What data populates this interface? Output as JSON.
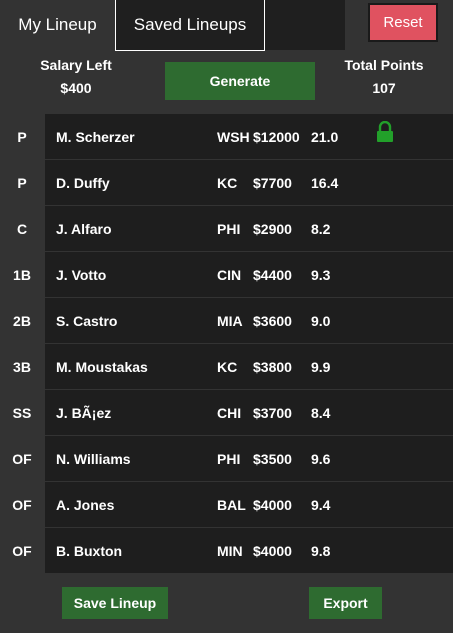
{
  "tabs": {
    "my_lineup": "My Lineup",
    "saved_lineups": "Saved Lineups"
  },
  "reset_label": "Reset",
  "salary": {
    "label": "Salary Left",
    "value": "$400"
  },
  "points": {
    "label": "Total Points",
    "value": "107"
  },
  "generate_label": "Generate",
  "roster": [
    {
      "pos": "P",
      "name": "M. Scherzer",
      "team": "WSH",
      "salary": "$12000",
      "points": "21.0",
      "locked": true
    },
    {
      "pos": "P",
      "name": "D. Duffy",
      "team": "KC",
      "salary": "$7700",
      "points": "16.4",
      "locked": false
    },
    {
      "pos": "C",
      "name": "J. Alfaro",
      "team": "PHI",
      "salary": "$2900",
      "points": "8.2",
      "locked": false
    },
    {
      "pos": "1B",
      "name": "J. Votto",
      "team": "CIN",
      "salary": "$4400",
      "points": "9.3",
      "locked": false
    },
    {
      "pos": "2B",
      "name": "S. Castro",
      "team": "MIA",
      "salary": "$3600",
      "points": "9.0",
      "locked": false
    },
    {
      "pos": "3B",
      "name": "M. Moustakas",
      "team": "KC",
      "salary": "$3800",
      "points": "9.9",
      "locked": false
    },
    {
      "pos": "SS",
      "name": "J. BÃ¡ez",
      "team": "CHI",
      "salary": "$3700",
      "points": "8.4",
      "locked": false
    },
    {
      "pos": "OF",
      "name": "N. Williams",
      "team": "PHI",
      "salary": "$3500",
      "points": "9.6",
      "locked": false
    },
    {
      "pos": "OF",
      "name": "A. Jones",
      "team": "BAL",
      "salary": "$4000",
      "points": "9.4",
      "locked": false
    },
    {
      "pos": "OF",
      "name": "B. Buxton",
      "team": "MIN",
      "salary": "$4000",
      "points": "9.8",
      "locked": false
    }
  ],
  "footer": {
    "save_label": "Save Lineup",
    "export_label": "Export"
  },
  "colors": {
    "background": "#333333",
    "row": "#1e1e1e",
    "button_green": "#2e6b30",
    "reset_red": "#e05260",
    "lock_green": "#22a02a"
  },
  "icons": {
    "lock": "lock-icon"
  }
}
